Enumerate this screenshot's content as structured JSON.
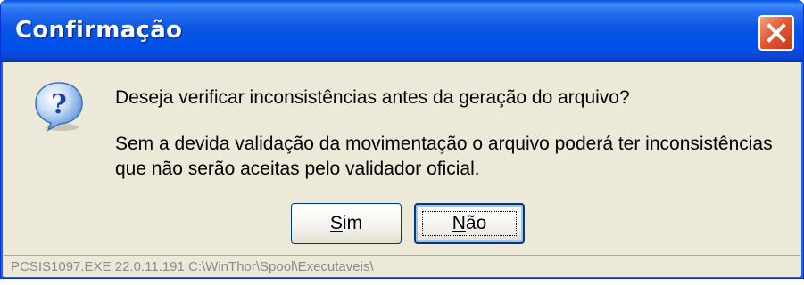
{
  "window": {
    "title": "Confirmação",
    "close_icon": "close-icon"
  },
  "dialog": {
    "icon": "question-icon",
    "question": "Deseja verificar inconsistências antes da geração do arquivo?",
    "detail_line1": "Sem a devida validação da movimentação o arquivo poderá ter inconsistências",
    "detail_line2": "que não serão aceitas pelo validador oficial."
  },
  "buttons": {
    "yes": {
      "access_key": "S",
      "rest": "im"
    },
    "no": {
      "access_key": "N",
      "rest": "ão"
    }
  },
  "status": {
    "text": "PCSIS1097.EXE 22.0.11.191 C:\\WinThor\\Spool\\Executaveis\\"
  },
  "colors": {
    "titlebar": "#0054e3",
    "close": "#e35a35",
    "face": "#ece9d8"
  }
}
